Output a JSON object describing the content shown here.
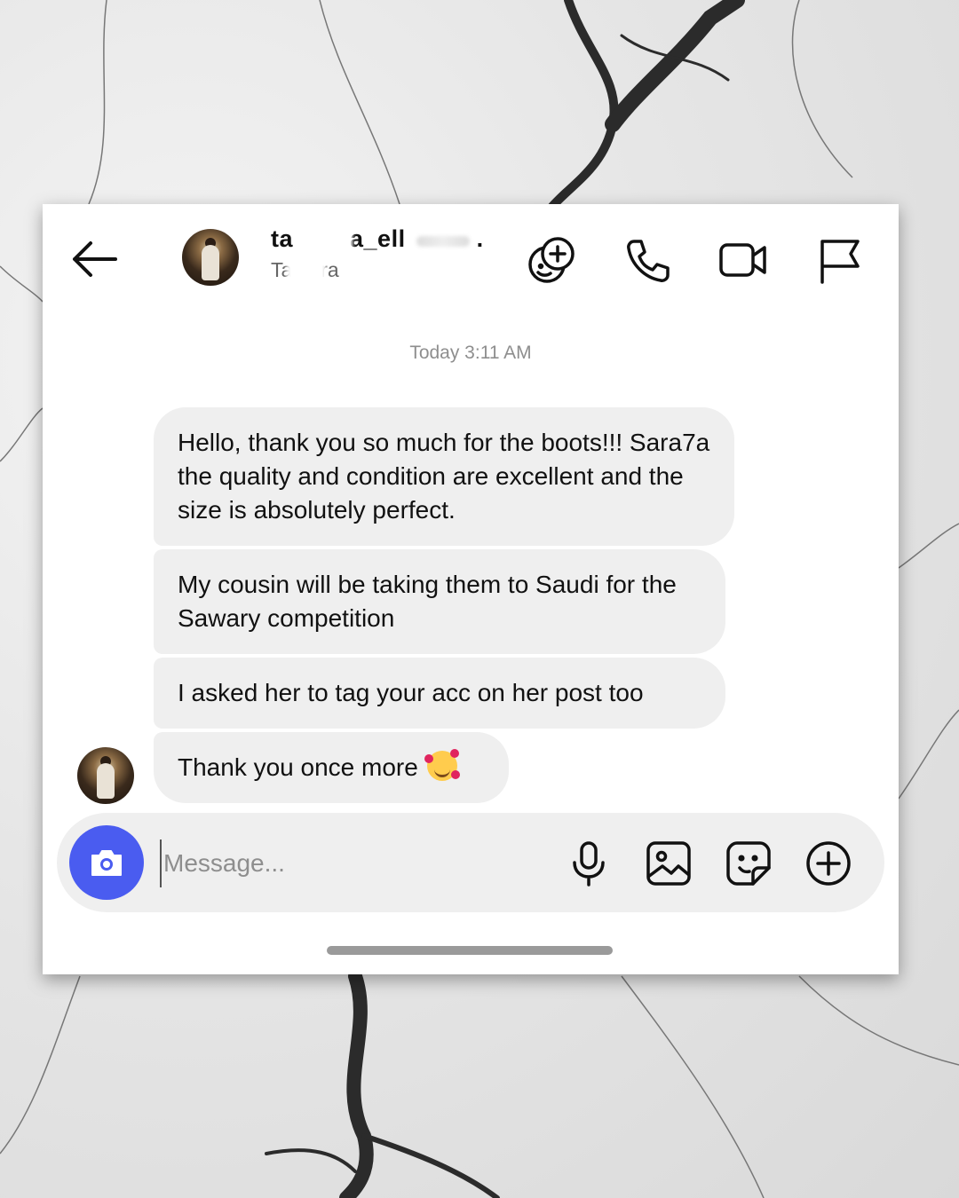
{
  "header": {
    "username": "ta        a_ell          .",
    "full_name": "Ta     ra",
    "icons": [
      "back-arrow-icon",
      "effects-sticker-icon",
      "phone-icon",
      "video-camera-icon",
      "flag-icon"
    ]
  },
  "thread": {
    "timestamp": "Today 3:11 AM",
    "messages": [
      {
        "text": "Hello, thank you so much for the boots!!! Sara7a the quality and condition are excellent and the size is absolutely perfect."
      },
      {
        "text": "My cousin will be taking them to Saudi for the Sawary competition"
      },
      {
        "text": "I asked her to tag your acc on her post too"
      },
      {
        "text": "Thank you once more",
        "emoji": "smiling-face-with-hearts"
      }
    ]
  },
  "composer": {
    "placeholder": "Message...",
    "value": "",
    "accent_color": "#4a5cf0",
    "icons": [
      "camera-icon",
      "microphone-icon",
      "gallery-icon",
      "sticker-icon",
      "add-icon"
    ]
  }
}
